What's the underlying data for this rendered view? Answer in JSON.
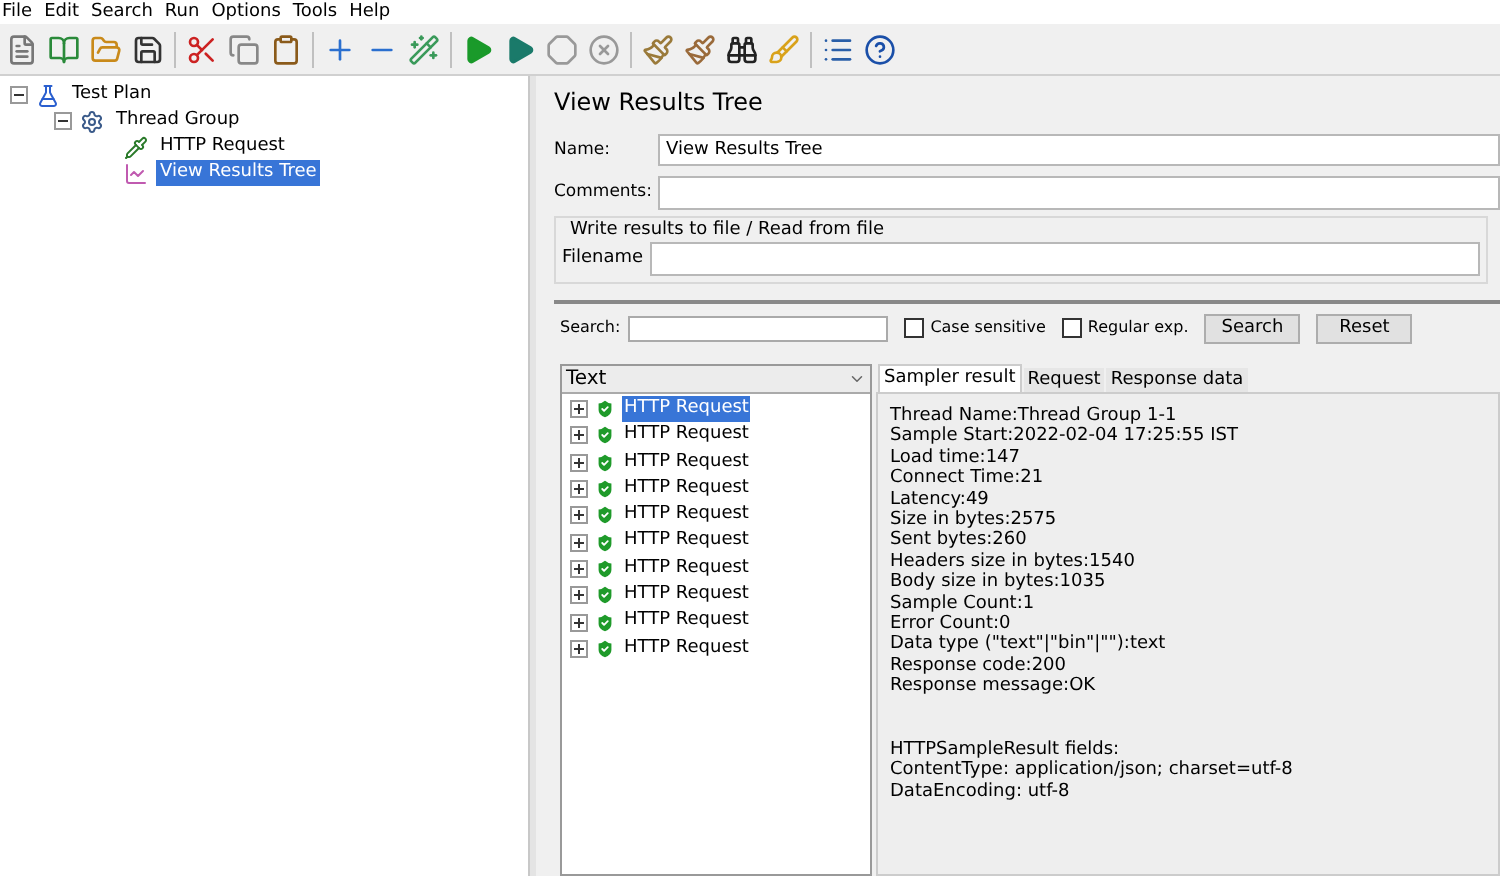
{
  "menu": [
    "File",
    "Edit",
    "Search",
    "Run",
    "Options",
    "Tools",
    "Help"
  ],
  "tree": [
    {
      "label": "Test Plan",
      "kind": "plan",
      "expanded": true,
      "selected": false,
      "children": [
        {
          "label": "Thread Group",
          "kind": "threads",
          "expanded": true,
          "selected": false,
          "children": [
            {
              "label": "HTTP Request",
              "kind": "sampler",
              "selected": false
            },
            {
              "label": "View Results Tree",
              "kind": "listener",
              "selected": true
            }
          ]
        }
      ]
    }
  ],
  "panel": {
    "title": "View Results Tree",
    "name_field": {
      "label": "Name:",
      "value": "View Results Tree"
    },
    "comments_field": {
      "label": "Comments:"
    },
    "file_group": {
      "title": "Write results to file / Read from file",
      "filename_label": "Filename"
    },
    "search": {
      "label": "Search:",
      "options": [
        {
          "label": "Case sensitive",
          "checked": false
        },
        {
          "label": "Regular exp.",
          "checked": false
        }
      ],
      "buttons": [
        "Search",
        "Reset"
      ]
    },
    "results": {
      "column_header": "Text",
      "rows": [
        {
          "label": "HTTP Request",
          "selected": true
        },
        {
          "label": "HTTP Request",
          "selected": false
        },
        {
          "label": "HTTP Request",
          "selected": false
        },
        {
          "label": "HTTP Request",
          "selected": false
        },
        {
          "label": "HTTP Request",
          "selected": false
        },
        {
          "label": "HTTP Request",
          "selected": false
        },
        {
          "label": "HTTP Request",
          "selected": false
        },
        {
          "label": "HTTP Request",
          "selected": false
        },
        {
          "label": "HTTP Request",
          "selected": false
        },
        {
          "label": "HTTP Request",
          "selected": false
        }
      ],
      "tabs": [
        {
          "label": "Sampler result",
          "selected": true
        },
        {
          "label": "Request",
          "selected": false
        },
        {
          "label": "Response data",
          "selected": false
        }
      ],
      "sections": [
        [
          "Thread Name:Thread Group 1-1",
          "Sample Start:2022-02-04 17:25:55 IST",
          "Load time:147",
          "Connect Time:21",
          "Latency:49",
          "Size in bytes:2575",
          "Sent bytes:260",
          "Headers size in bytes:1540",
          "Body size in bytes:1035",
          "Sample Count:1",
          "Error Count:0",
          "Data type (\"text\"|\"bin\"|\"\"):text",
          "Response code:200",
          "Response message:OK"
        ],
        [
          "HTTPSampleResult fields:",
          "ContentType: application/json; charset=utf-8",
          "DataEncoding: utf-8"
        ]
      ]
    }
  }
}
